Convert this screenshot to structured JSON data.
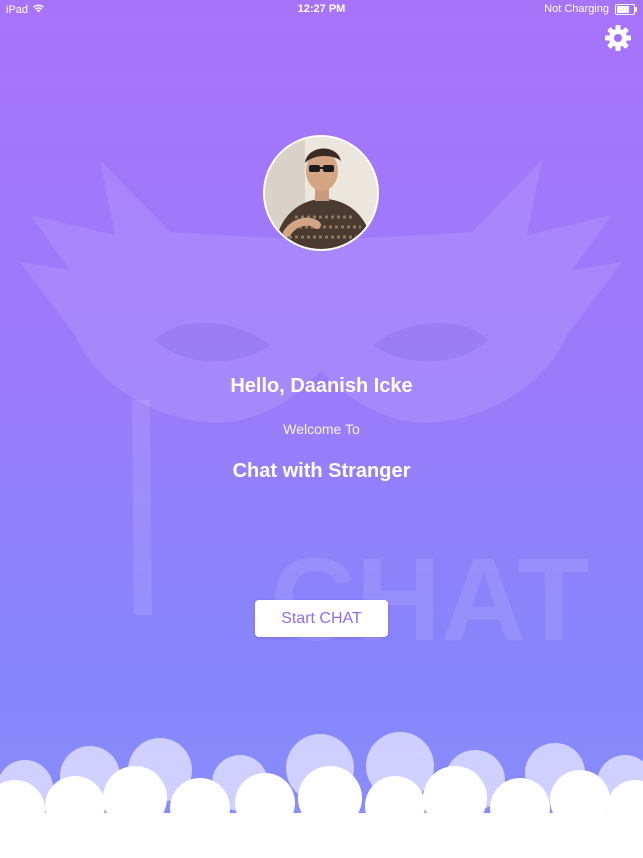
{
  "status_bar": {
    "device": "iPad",
    "time": "12:27 PM",
    "charging": "Not Charging",
    "battery_level": 0.85
  },
  "settings": {
    "icon": "gear-icon"
  },
  "watermark": {
    "text": "CHAT",
    "icon": "mask-icon"
  },
  "profile": {
    "avatar_icon": "user-photo-avatar"
  },
  "main": {
    "greeting": "Hello, Daanish Icke",
    "welcome": "Welcome To",
    "app_title": "Chat with Stranger",
    "start_button": "Start CHAT"
  },
  "colors": {
    "gradient_top": "#a873fb",
    "gradient_bottom": "#8a8ffb",
    "button_text": "#8f6af5",
    "text": "#ffffff"
  }
}
